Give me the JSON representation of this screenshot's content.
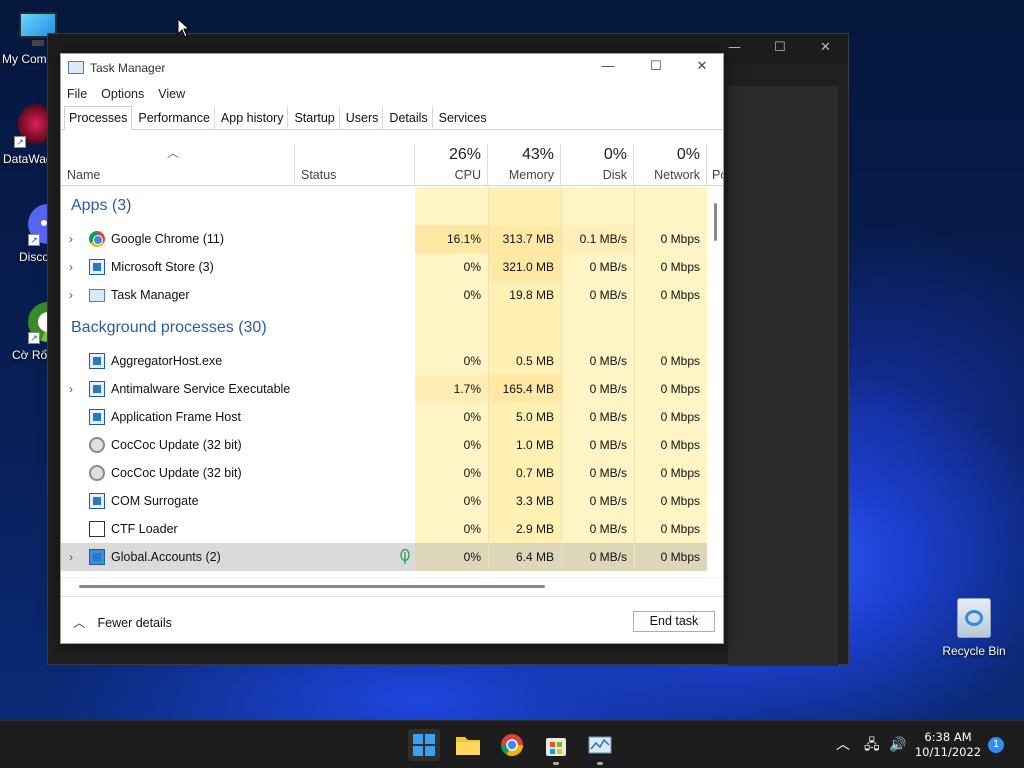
{
  "desktop": {
    "icons": [
      {
        "label": "My Com",
        "icon": "computer-icon"
      },
      {
        "label": "DataWag",
        "icon": "datawag-icon"
      },
      {
        "label": "Disco",
        "icon": "discord-icon"
      },
      {
        "label": "Cờ Rốn",
        "icon": "coccoc-icon"
      },
      {
        "label": "Recycle Bin",
        "icon": "recycle-bin-icon"
      }
    ]
  },
  "task_manager": {
    "title": "Task Manager",
    "menu": [
      "File",
      "Options",
      "View"
    ],
    "tabs": [
      "Processes",
      "Performance",
      "App history",
      "Startup",
      "Users",
      "Details",
      "Services"
    ],
    "active_tab": "Processes",
    "columns": {
      "name": "Name",
      "status": "Status",
      "cpu": {
        "pct": "26%",
        "label": "CPU"
      },
      "memory": {
        "pct": "43%",
        "label": "Memory"
      },
      "disk": {
        "pct": "0%",
        "label": "Disk"
      },
      "network": {
        "pct": "0%",
        "label": "Network"
      },
      "power": "Po"
    },
    "groups": {
      "apps": "Apps (3)",
      "background": "Background processes (30)"
    },
    "apps": [
      {
        "name": "Google Chrome (11)",
        "cpu": "16.1%",
        "memory": "313.7 MB",
        "disk": "0.1 MB/s",
        "network": "0 Mbps",
        "icon": "chrome-icon",
        "expandable": true
      },
      {
        "name": "Microsoft Store (3)",
        "cpu": "0%",
        "memory": "321.0 MB",
        "disk": "0 MB/s",
        "network": "0 Mbps",
        "icon": "store-icon",
        "expandable": true
      },
      {
        "name": "Task Manager",
        "cpu": "0%",
        "memory": "19.8 MB",
        "disk": "0 MB/s",
        "network": "0 Mbps",
        "icon": "task-manager-icon",
        "expandable": true
      }
    ],
    "background": [
      {
        "name": "AggregatorHost.exe",
        "cpu": "0%",
        "memory": "0.5 MB",
        "disk": "0 MB/s",
        "network": "0 Mbps",
        "icon": "window-icon",
        "expandable": false
      },
      {
        "name": "Antimalware Service Executable",
        "cpu": "1.7%",
        "memory": "165.4 MB",
        "disk": "0 MB/s",
        "network": "0 Mbps",
        "icon": "window-icon",
        "expandable": true
      },
      {
        "name": "Application Frame Host",
        "cpu": "0%",
        "memory": "5.0 MB",
        "disk": "0 MB/s",
        "network": "0 Mbps",
        "icon": "window-icon",
        "expandable": false
      },
      {
        "name": "CocCoc Update (32 bit)",
        "cpu": "0%",
        "memory": "1.0 MB",
        "disk": "0 MB/s",
        "network": "0 Mbps",
        "icon": "coccoc-update-icon",
        "expandable": false
      },
      {
        "name": "CocCoc Update (32 bit)",
        "cpu": "0%",
        "memory": "0.7 MB",
        "disk": "0 MB/s",
        "network": "0 Mbps",
        "icon": "coccoc-update-icon",
        "expandable": false
      },
      {
        "name": "COM Surrogate",
        "cpu": "0%",
        "memory": "3.3 MB",
        "disk": "0 MB/s",
        "network": "0 Mbps",
        "icon": "window-icon",
        "expandable": false
      },
      {
        "name": "CTF Loader",
        "cpu": "0%",
        "memory": "2.9 MB",
        "disk": "0 MB/s",
        "network": "0 Mbps",
        "icon": "ctf-icon",
        "expandable": false
      },
      {
        "name": "Global.Accounts (2)",
        "cpu": "0%",
        "memory": "6.4 MB",
        "disk": "0 MB/s",
        "network": "0 Mbps",
        "icon": "accounts-icon",
        "expandable": true,
        "selected": true,
        "status_icon": "eco-leaf-icon"
      }
    ],
    "footer": {
      "fewer_details": "Fewer details",
      "end_task": "End task"
    }
  },
  "taskbar": {
    "apps": [
      "start-icon",
      "file-explorer-icon",
      "chrome-icon",
      "store-icon",
      "task-manager-icon"
    ],
    "clock": {
      "time": "6:38 AM",
      "date": "10/11/2022"
    },
    "notification_count": "1"
  }
}
